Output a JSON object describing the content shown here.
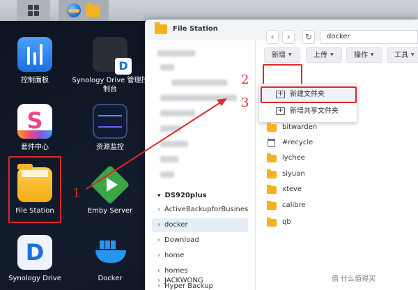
{
  "desktop": {
    "icons": [
      {
        "label": "控制面板"
      },
      {
        "label": "Synology Drive 管理控制台"
      },
      {
        "label": "套件中心"
      },
      {
        "label": "资源监控"
      },
      {
        "label": "File Station"
      },
      {
        "label": "Emby Server"
      },
      {
        "label": "Synology Drive"
      },
      {
        "label": "Docker"
      }
    ]
  },
  "window": {
    "title": "File Station",
    "sidebar": {
      "root": "DS920plus",
      "items": [
        "ActiveBackupforBusiness",
        "docker",
        "Download",
        "home",
        "homes",
        "Hyper Backup",
        "JACKWONG"
      ]
    },
    "toolbar": {
      "back": "‹",
      "forward": "›",
      "refresh": "↻",
      "path": "docker",
      "new_label": "新增",
      "upload_label": "上传",
      "action_label": "操作",
      "tools_label": "工具"
    },
    "new_menu": {
      "items": [
        {
          "label": "新建文件夹"
        },
        {
          "label": "新增共享文件夹"
        }
      ]
    },
    "files": [
      "bitwarden",
      "#recycle",
      "lychee",
      "siyuan",
      "xteve",
      "calibre",
      "qb"
    ]
  },
  "annotations": {
    "step1": "1",
    "step2": "2",
    "step3": "3"
  },
  "watermark": "值 什么值得买",
  "colors": {
    "accent_red": "#e02828",
    "folder": "#f5b21e",
    "taskbar": "#c4c8cf"
  }
}
